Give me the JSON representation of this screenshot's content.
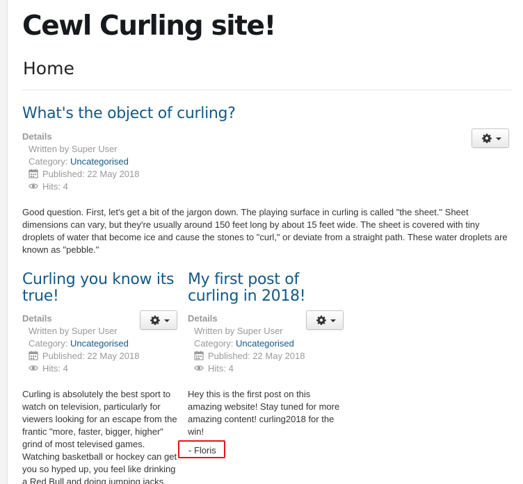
{
  "site": {
    "title": "Cewl Curling site!",
    "page_heading": "Home"
  },
  "labels": {
    "details": "Details",
    "category_prefix": "Category: "
  },
  "articles": [
    {
      "title": "What's the object of curling?",
      "written_by": "Written by Super User",
      "category": "Uncategorised",
      "published": "Published: 22 May 2018",
      "hits": "Hits: 4",
      "body": "Good question. First, let's get a bit of the jargon down. The playing surface in curling is called \"the sheet.\" Sheet dimensions can vary, but they're usually around 150 feet long by about 15 feet wide. The sheet is covered with tiny droplets of water that become ice and cause the stones to \"curl,\" or deviate from a straight path. These water droplets are known as \"pebble.\""
    },
    {
      "title": "Curling you know its true!",
      "written_by": "Written by Super User",
      "category": "Uncategorised",
      "published": "Published: 22 May 2018",
      "hits": "Hits: 4",
      "body": "Curling is absolutely the best sport to watch on television, particularly for viewers looking for an escape from the frantic \"more, faster, bigger, higher\" grind of most televised games. Watching basketball or hockey can get you so hyped up, you feel like drinking a Red Bull and doing jumping jacks."
    },
    {
      "title": "My first post of curling in 2018!",
      "written_by": "Written by Super User",
      "category": "Uncategorised",
      "published": "Published: 22 May 2018",
      "hits": "Hits: 4",
      "body": "Hey this is the first post on this amazing website! Stay tuned for more amazing content! curling2018 for the win!",
      "signature": "- Floris"
    }
  ],
  "icons": {
    "calendar": "calendar-icon",
    "hits": "eye-icon",
    "tools": "gear-icon",
    "dropdown": "caret-down-icon"
  },
  "colors": {
    "link": "#135885",
    "meta": "#999999",
    "highlight_border": "#e8121b"
  }
}
